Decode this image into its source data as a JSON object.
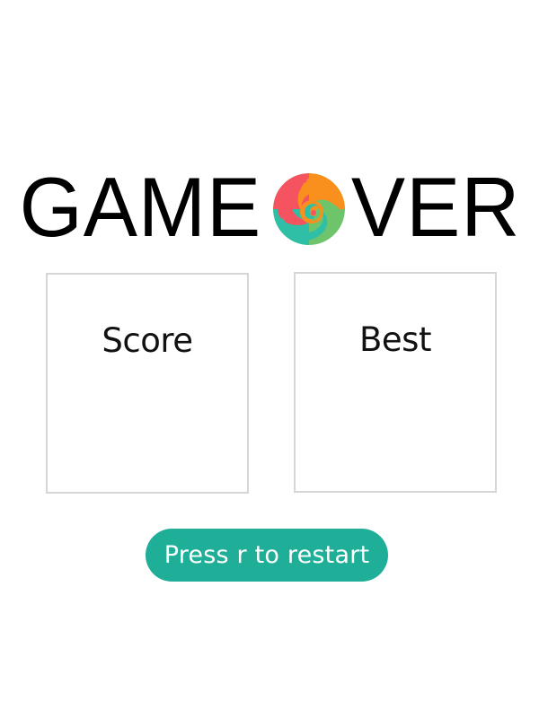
{
  "title": {
    "part1": "GAME",
    "part2": "VER"
  },
  "logo": {
    "icon": "rainbow-swirl-icon",
    "colors": [
      "#f5535f",
      "#f98f1c",
      "#2fbfa6",
      "#6ec46a"
    ]
  },
  "score_panel": {
    "label": "Score"
  },
  "best_panel": {
    "label": "Best"
  },
  "restart": {
    "label": "Press r to restart",
    "color": "#1fae98"
  }
}
